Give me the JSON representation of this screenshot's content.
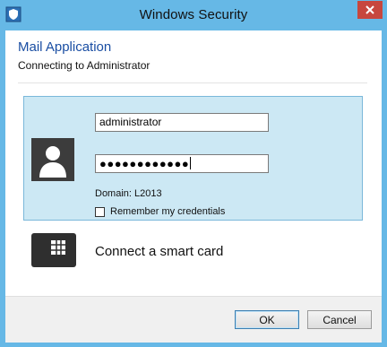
{
  "window": {
    "title": "Windows Security",
    "icons": {
      "app": "security-shield-icon",
      "close": "close-icon"
    },
    "colors": {
      "frame": "#66b8e6",
      "close": "#c7473e",
      "heading": "#1a4ea3",
      "tile_bg": "#cce8f4",
      "tile_border": "#7ab8da"
    }
  },
  "header": {
    "app_name": "Mail Application",
    "subtitle": "Connecting to Administrator"
  },
  "credential_tile": {
    "avatar_icon": "user-avatar-icon",
    "username_value": "administrator",
    "password_mask": "●●●●●●●●●●●●",
    "domain_text": "Domain: L2013",
    "remember_label": "Remember my credentials",
    "remember_checked": false
  },
  "smart_card": {
    "icon": "smart-card-icon",
    "label": "Connect a smart card"
  },
  "buttons": {
    "ok": "OK",
    "cancel": "Cancel"
  }
}
